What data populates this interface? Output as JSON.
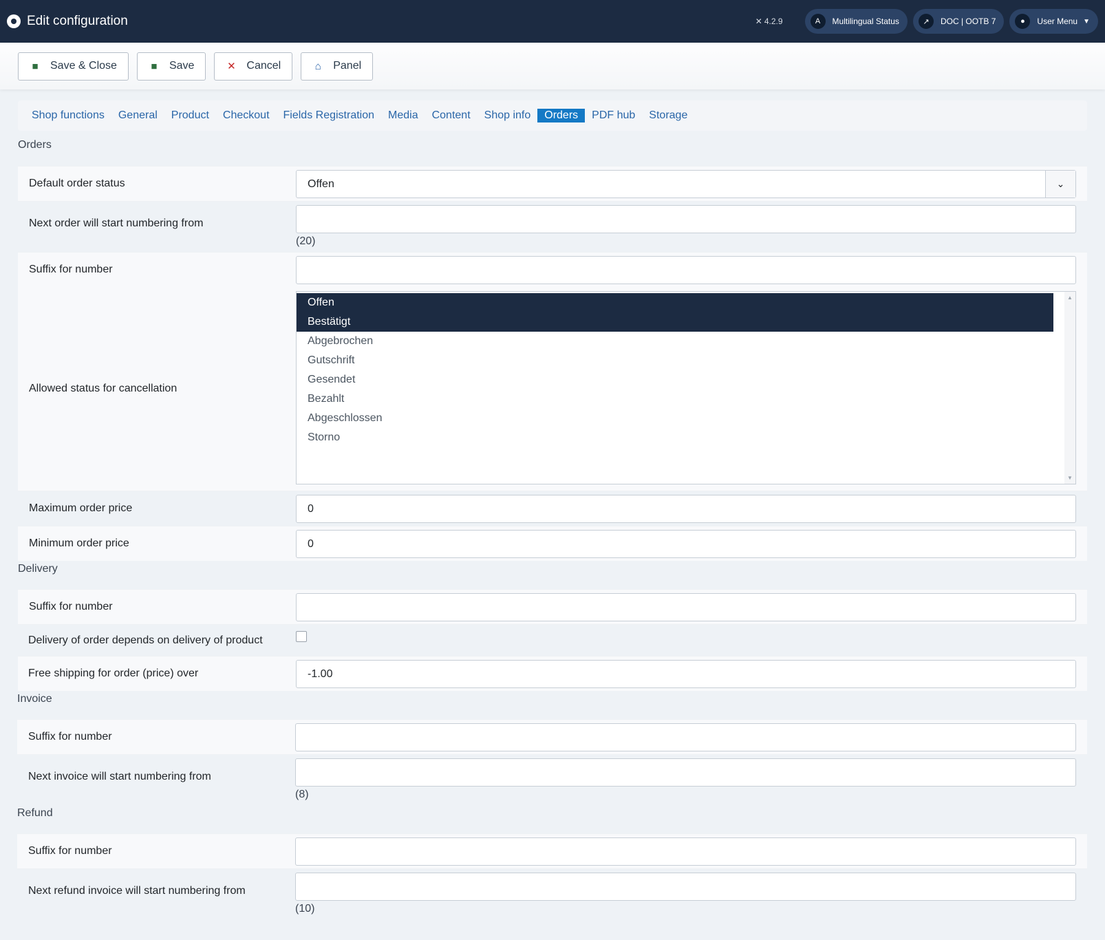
{
  "header": {
    "title": "Edit configuration",
    "version": "4.2.9",
    "multilingual": "Multilingual Status",
    "doc": "DOC | OOTB 7",
    "user_menu": "User Menu"
  },
  "toolbar": {
    "save_close": "Save & Close",
    "save": "Save",
    "cancel": "Cancel",
    "panel": "Panel"
  },
  "tabs": [
    "Shop functions",
    "General",
    "Product",
    "Checkout",
    "Fields Registration",
    "Media",
    "Content",
    "Shop info",
    "Orders",
    "PDF hub",
    "Storage"
  ],
  "orders": {
    "title": "Orders",
    "default_status_label": "Default order status",
    "default_status_value": "Offen",
    "next_order_label": "Next order will start numbering from",
    "next_order_value": "",
    "next_order_hint": "(20)",
    "suffix_label": "Suffix for number",
    "suffix_value": "",
    "cancel_label": "Allowed status for cancellation",
    "cancel_options": [
      "Offen",
      "Bestätigt",
      "Abgebrochen",
      "Gutschrift",
      "Gesendet",
      "Bezahlt",
      "Abgeschlossen",
      "Storno"
    ],
    "max_label": "Maximum order price",
    "max_value": "0",
    "min_label": "Minimum order price",
    "min_value": "0"
  },
  "delivery": {
    "title": "Delivery",
    "suffix_label": "Suffix for number",
    "suffix_value": "",
    "depends_label": "Delivery of order depends on delivery of product",
    "free_label": "Free shipping for order (price) over",
    "free_value": "-1.00"
  },
  "invoice": {
    "title": "Invoice",
    "suffix_label": "Suffix for number",
    "suffix_value": "",
    "next_label": "Next invoice will start numbering from",
    "next_value": "",
    "next_hint": "(8)"
  },
  "refund": {
    "title": "Refund",
    "suffix_label": "Suffix for number",
    "suffix_value": "",
    "next_label": "Next refund invoice will start numbering from",
    "next_value": "",
    "next_hint": "(10)"
  }
}
